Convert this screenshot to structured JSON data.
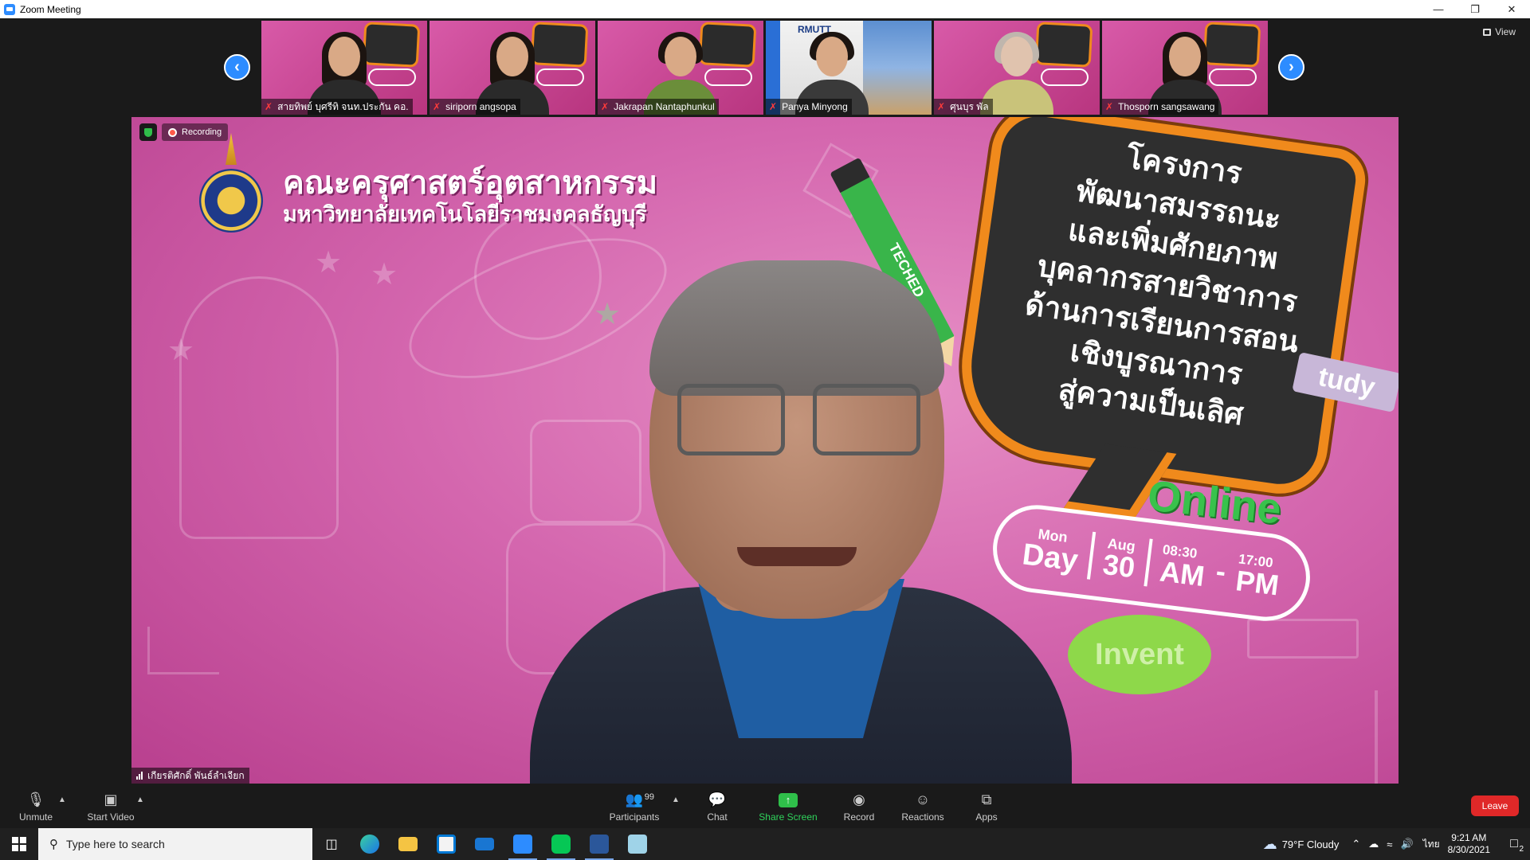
{
  "window": {
    "title": "Zoom Meeting",
    "controls": [
      "minimize",
      "restore",
      "close"
    ]
  },
  "gallery": {
    "tiles": [
      {
        "name": "สายทิพย์ บุศรีทิ จนท.ประกัน คอ.",
        "style": "pink"
      },
      {
        "name": "siriporn angsopa",
        "style": "pink"
      },
      {
        "name": "Jakrapan Nantaphunkul",
        "style": "pink"
      },
      {
        "name": "Panya Minyong",
        "style": "alt"
      },
      {
        "name": "ศุนบุร พัล",
        "style": "pink"
      },
      {
        "name": "Thosporn sangsawang",
        "style": "pink"
      }
    ],
    "view_label": "View"
  },
  "main_video": {
    "recording_label": "Recording",
    "speaker_name": "เกียรติศักดิ์ พันธ์ลำเจียก",
    "background": {
      "faculty_line1": "คณะครุศาสตร์อุตสาหกรรม",
      "faculty_line2": "มหาวิทยาลัยเทคโนโลยีราชมงคลธัญบุรี",
      "project_lines": [
        "โครงการ",
        "พัฒนาสมรรถนะ",
        "และเพิ่มศักยภาพ",
        "บุคลากรสายวิชาการ",
        "ด้านการเรียนการสอน",
        "เชิงบูรณาการ",
        "สู่ความเป็นเลิศ"
      ],
      "pencil_text": "TECHED",
      "online": "Online",
      "date": {
        "mon": "Mon",
        "day": "Day",
        "aug": "Aug",
        "date_num": "30",
        "t1": "08:30",
        "t1b": "AM",
        "dash": "-",
        "t2": "17:00",
        "t2b": "PM"
      },
      "invent": "Invent",
      "study": "tudy"
    }
  },
  "toolbar": {
    "unmute": "Unmute",
    "start_video": "Start Video",
    "participants": "Participants",
    "participant_count": "99",
    "chat": "Chat",
    "share_screen": "Share Screen",
    "record": "Record",
    "reactions": "Reactions",
    "apps": "Apps",
    "leave": "Leave"
  },
  "taskbar": {
    "search_placeholder": "Type here to search",
    "weather": "79°F  Cloudy",
    "language": "ไทย",
    "time": "9:21 AM",
    "date": "8/30/2021",
    "notifications": "2"
  },
  "colors": {
    "accent": "#2d8cff",
    "leave": "#e02828",
    "share": "#2fbf4a",
    "stage": "#1a1a1a"
  }
}
